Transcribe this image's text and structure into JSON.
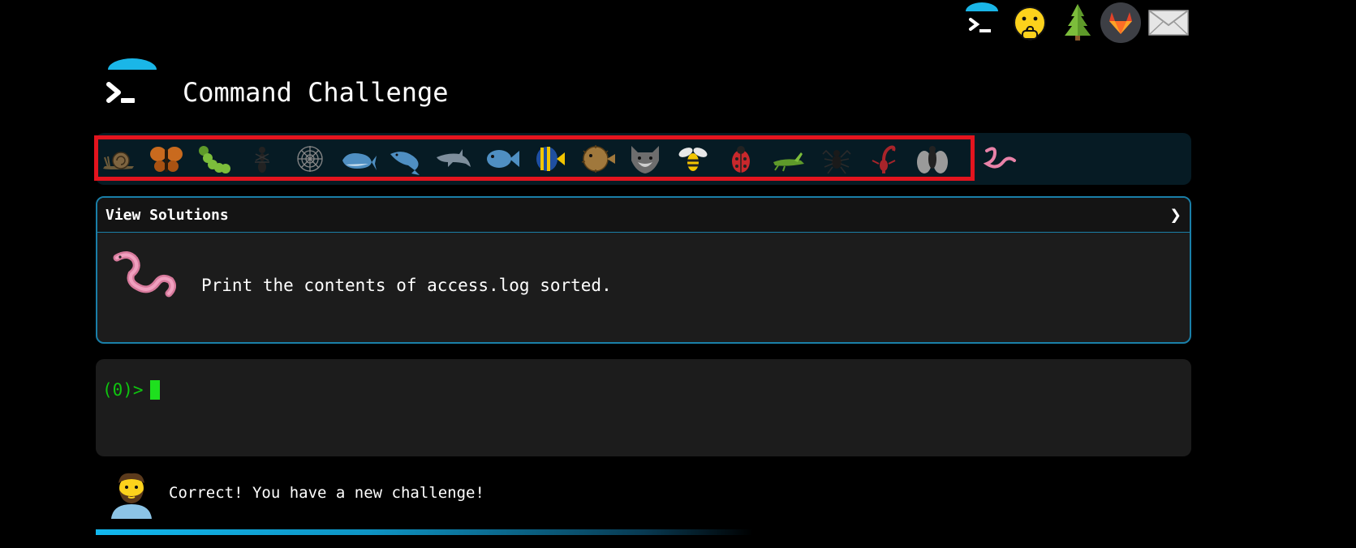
{
  "header": {
    "title": "Command Challenge",
    "top_icons": [
      "terminal-logo-icon",
      "shushing-face-icon",
      "evergreen-tree-icon",
      "gitlab-icon",
      "envelope-icon"
    ]
  },
  "level_bar": {
    "animals": [
      "snail",
      "butterfly",
      "caterpillar",
      "ant",
      "spider-web",
      "whale",
      "spouting-whale",
      "dolphin",
      "fish",
      "tropical-fish",
      "blowfish",
      "wolf",
      "bee",
      "lady-beetle",
      "cricket",
      "spider",
      "scorpion",
      "fly",
      "worm"
    ],
    "highlighted_count": 18,
    "current": "worm"
  },
  "solutions": {
    "label": "View Solutions",
    "toggle": "❯",
    "challenge_animal": "worm",
    "challenge_text": "Print the contents of access.log sorted."
  },
  "terminal": {
    "prompt": "(0)>",
    "input": ""
  },
  "status": {
    "message": "Correct! You have a new challenge!",
    "avatar": "bearded-man-icon"
  },
  "colors": {
    "accent": "#1a7fa8",
    "prompt_green": "#0fc50f",
    "highlight_red": "#e3141e"
  }
}
